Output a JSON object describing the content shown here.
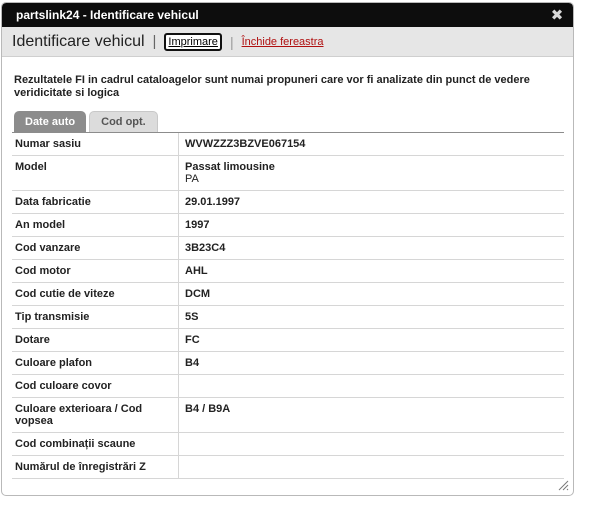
{
  "window": {
    "title": "partslink24 - Identificare vehicul"
  },
  "toolbar": {
    "heading": "Identificare vehicul",
    "separator": "|",
    "print_label": "Imprimare",
    "close_window_label": "Închide fereastra"
  },
  "notice": "Rezultatele FI in cadrul cataloagelor sunt numai propuneri care vor fi analizate din punct de vedere veridicitate si logica",
  "tabs": [
    {
      "label": "Date auto",
      "active": true
    },
    {
      "label": "Cod opt.",
      "active": false
    }
  ],
  "rows": [
    {
      "label": "Numar sasiu",
      "value": "WVWZZZ3BZVE067154",
      "sub": ""
    },
    {
      "label": "Model",
      "value": "Passat limousine",
      "sub": "PA"
    },
    {
      "label": "Data fabricatie",
      "value": "29.01.1997",
      "sub": ""
    },
    {
      "label": "An model",
      "value": "1997",
      "sub": ""
    },
    {
      "label": "Cod vanzare",
      "value": "3B23C4",
      "sub": ""
    },
    {
      "label": "Cod motor",
      "value": "AHL",
      "sub": ""
    },
    {
      "label": "Cod cutie de viteze",
      "value": "DCM",
      "sub": ""
    },
    {
      "label": "Tip transmisie",
      "value": "5S",
      "sub": ""
    },
    {
      "label": "Dotare",
      "value": "FC",
      "sub": ""
    },
    {
      "label": "Culoare plafon",
      "value": "B4",
      "sub": ""
    },
    {
      "label": "Cod culoare covor",
      "value": "",
      "sub": ""
    },
    {
      "label": "Culoare exterioara / Cod vopsea",
      "value": "B4 / B9A",
      "sub": ""
    },
    {
      "label": "Cod combinații scaune",
      "value": "",
      "sub": ""
    },
    {
      "label": "Numărul de înregistrări Z",
      "value": "",
      "sub": ""
    }
  ],
  "icons": {
    "close": "close-icon",
    "resize": "resize-grip-icon"
  }
}
